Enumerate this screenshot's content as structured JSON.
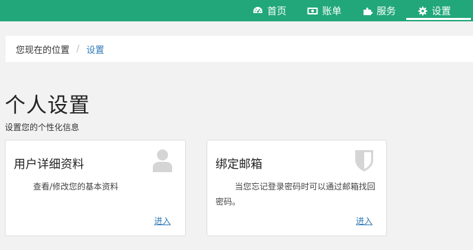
{
  "nav": {
    "items": [
      {
        "label": "首页",
        "icon": "dashboard-icon"
      },
      {
        "label": "账单",
        "icon": "bill-icon"
      },
      {
        "label": "服务",
        "icon": "puzzle-icon"
      },
      {
        "label": "设置",
        "icon": "gear-icon",
        "active": true
      }
    ]
  },
  "breadcrumb": {
    "home": "您现在的位置",
    "separator": "/",
    "current": "设置"
  },
  "header": {
    "title": "个人设置",
    "subtitle": "设置您的个性化信息"
  },
  "cards": [
    {
      "title": "用户详细资料",
      "icon": "user-icon",
      "description": "查看/修改您的基本资料",
      "link": "进入"
    },
    {
      "title": "绑定邮箱",
      "icon": "shield-icon",
      "description": "当您忘记登录密码时可以通过邮箱找回密码。",
      "link": "进入"
    }
  ],
  "colors": {
    "topbar": "#21a77a",
    "link": "#337ab7",
    "background": "#f2f2f2"
  }
}
